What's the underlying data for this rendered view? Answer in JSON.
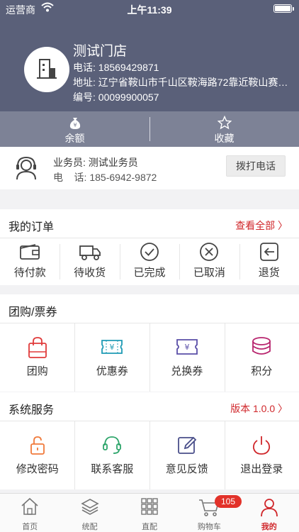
{
  "status_bar": {
    "carrier": "运营商",
    "time": "上午11:39"
  },
  "store": {
    "name": "测试门店",
    "phone": "电话: 18569429871",
    "address": "地址: 辽宁省鞍山市千山区鞍海路72靠近鞍山赛诺…",
    "code": "编号: 00099900057"
  },
  "quick": {
    "balance_label": "余额",
    "favorites_label": "收藏"
  },
  "salesman": {
    "name": "业务员: 测试业务员",
    "phone": "电    话: 185-6942-9872",
    "call_label": "拨打电话"
  },
  "orders": {
    "title": "我的订单",
    "view_all": "查看全部 〉",
    "items": [
      {
        "label": "待付款",
        "icon": "wallet-icon"
      },
      {
        "label": "待收货",
        "icon": "truck-icon"
      },
      {
        "label": "已完成",
        "icon": "check-circle-icon"
      },
      {
        "label": "已取消",
        "icon": "cancel-circle-icon"
      },
      {
        "label": "退货",
        "icon": "return-icon"
      }
    ]
  },
  "groupbuy": {
    "title": "团购/票券",
    "items": [
      {
        "label": "团购",
        "icon": "shopping-bag-icon"
      },
      {
        "label": "优惠券",
        "icon": "coupon-icon"
      },
      {
        "label": "兑换券",
        "icon": "voucher-icon"
      },
      {
        "label": "积分",
        "icon": "coins-icon"
      }
    ]
  },
  "services": {
    "title": "系统服务",
    "version": "版本 1.0.0 〉",
    "items": [
      {
        "label": "修改密码",
        "icon": "lock-icon"
      },
      {
        "label": "联系客服",
        "icon": "headset-icon"
      },
      {
        "label": "意见反馈",
        "icon": "edit-icon"
      },
      {
        "label": "退出登录",
        "icon": "power-icon"
      }
    ]
  },
  "tabbar": {
    "items": [
      {
        "label": "首页",
        "icon": "home-icon"
      },
      {
        "label": "统配",
        "icon": "layers-icon"
      },
      {
        "label": "直配",
        "icon": "grid-icon"
      },
      {
        "label": "购物车",
        "icon": "cart-icon"
      },
      {
        "label": "我的",
        "icon": "user-icon"
      }
    ],
    "cart_badge": "105",
    "active_index": 4
  },
  "colors": {
    "header": "#5a6079",
    "quickbar": "#7d8296",
    "accent": "#d0272b"
  }
}
